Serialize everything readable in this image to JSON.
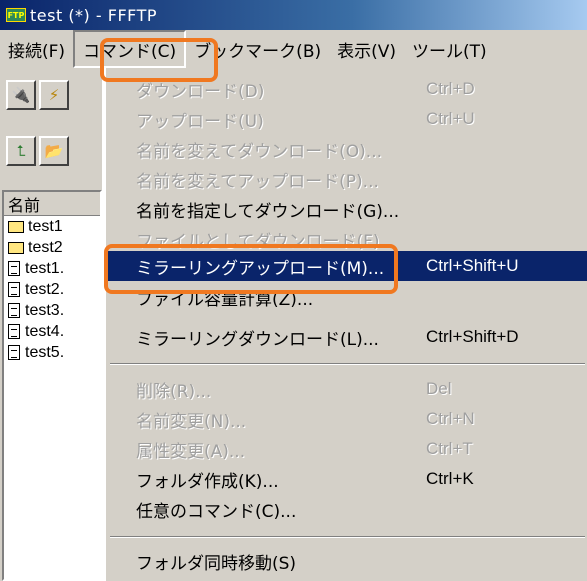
{
  "window": {
    "title": "test (*) - FFFTP",
    "app_icon_text": "FTP"
  },
  "menubar": [
    {
      "label": "接続(F)"
    },
    {
      "label": "コマンド(C)"
    },
    {
      "label": "ブックマーク(B)"
    },
    {
      "label": "表示(V)"
    },
    {
      "label": "ツール(T)"
    }
  ],
  "toolbar": [
    {
      "icon": "connect-plug-icon",
      "glyph": "🔌"
    },
    {
      "icon": "quick-connect-icon",
      "glyph": "⚡"
    },
    {
      "icon": "folder-up-icon",
      "glyph": "⮤"
    },
    {
      "icon": "open-folder-icon",
      "glyph": "📂"
    }
  ],
  "filelist": {
    "header": "名前",
    "items": [
      {
        "name": "test1",
        "type": "folder"
      },
      {
        "name": "test2",
        "type": "folder"
      },
      {
        "name": "test1.",
        "type": "file"
      },
      {
        "name": "test2.",
        "type": "file"
      },
      {
        "name": "test3.",
        "type": "file"
      },
      {
        "name": "test4.",
        "type": "file"
      },
      {
        "name": "test5.",
        "type": "file"
      }
    ]
  },
  "command_menu": {
    "items": [
      {
        "label": "ダウンロード(D)",
        "shortcut": "Ctrl+D",
        "disabled": true
      },
      {
        "label": "アップロード(U)",
        "shortcut": "Ctrl+U",
        "disabled": true
      },
      {
        "label": "名前を変えてダウンロード(O)...",
        "shortcut": "",
        "disabled": true
      },
      {
        "label": "名前を変えてアップロード(P)...",
        "shortcut": "",
        "disabled": true
      },
      {
        "label": "名前を指定してダウンロード(G)...",
        "shortcut": "",
        "disabled": false
      },
      {
        "label": "ファイルとしてダウンロード(F)",
        "shortcut": "",
        "disabled": true
      },
      {
        "label": "ミラーリングアップロード(M)...",
        "shortcut": "Ctrl+Shift+U",
        "highlighted": true
      },
      {
        "label": "ファイル容量計算(Z)...",
        "shortcut": "",
        "disabled": false
      },
      {
        "label": "ミラーリングダウンロード(L)...",
        "shortcut": "Ctrl+Shift+D",
        "disabled": false
      },
      {
        "label": "削除(R)...",
        "shortcut": "Del",
        "disabled": true
      },
      {
        "label": "名前変更(N)...",
        "shortcut": "Ctrl+N",
        "disabled": true
      },
      {
        "label": "属性変更(A)...",
        "shortcut": "Ctrl+T",
        "disabled": true
      },
      {
        "label": "フォルダ作成(K)...",
        "shortcut": "Ctrl+K",
        "disabled": false
      },
      {
        "label": "任意のコマンド(C)...",
        "shortcut": "",
        "disabled": false
      },
      {
        "label": "フォルダ同時移動(S)",
        "shortcut": "",
        "disabled": false
      }
    ]
  },
  "colors": {
    "highlight_ring": "#f07820",
    "selection": "#0a246a",
    "face": "#d4d0c8"
  }
}
